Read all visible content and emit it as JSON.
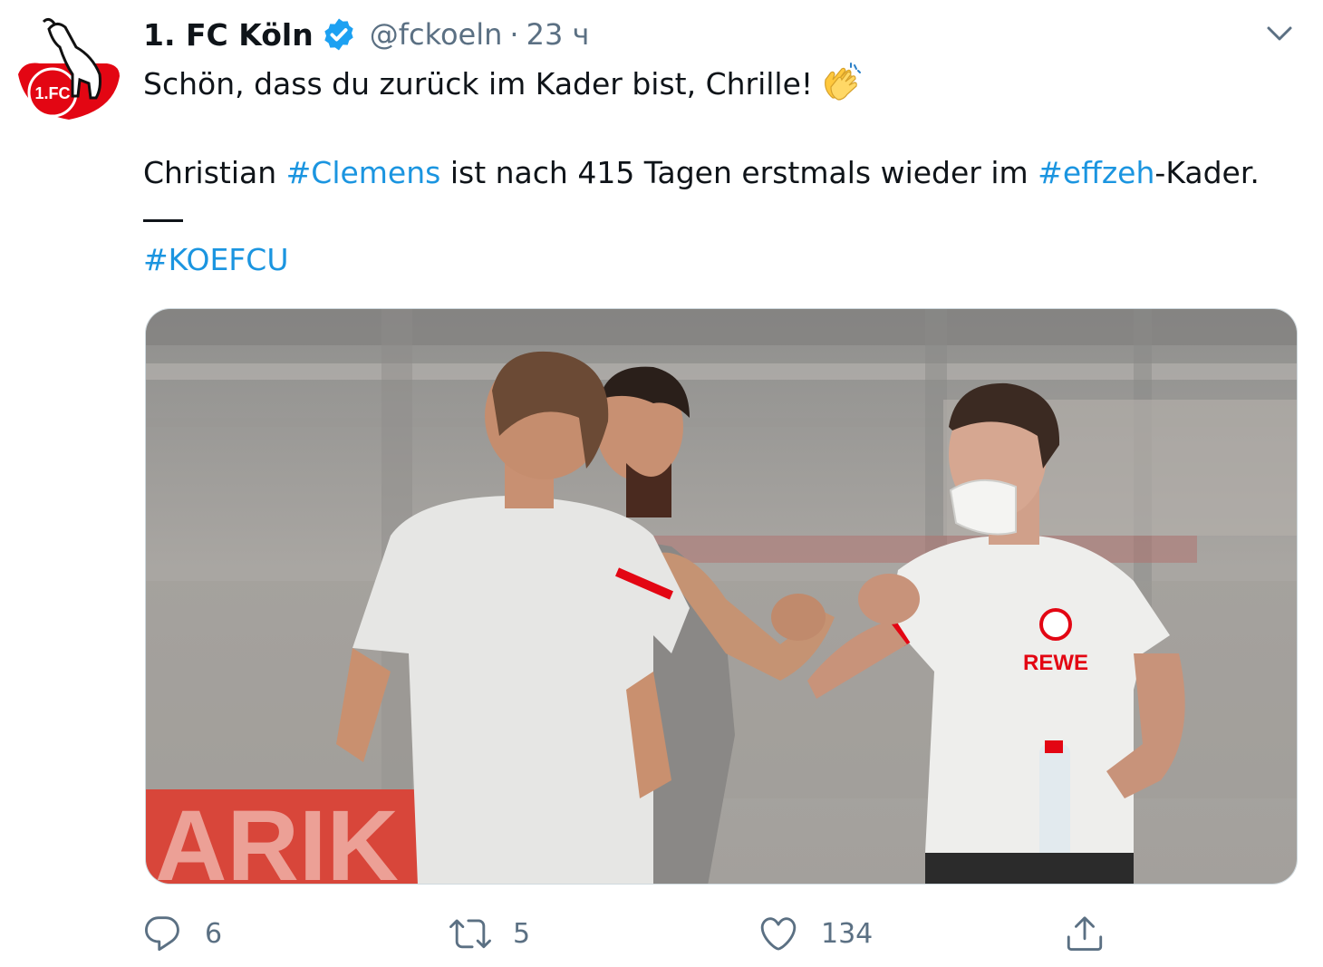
{
  "tweet": {
    "author_name": "1. FC Köln",
    "handle": "@fckoeln",
    "separator": "·",
    "timestamp": "23 ч",
    "text_line1": "Schön, dass du zurück im Kader bist, Chrille!",
    "line2_part1": "Christian ",
    "line2_hashtag1": "#Clemens",
    "line2_part2": " ist nach 415 Tagen erstmals wieder im ",
    "line2_hashtag2": "#effzeh",
    "line2_part3": "-Kader.",
    "divider": "__",
    "hashtag_line": "#KOEFCU",
    "verified": true,
    "emoji": "clapping-hands-emoji"
  },
  "media": {
    "logo_text": "REWE",
    "banner_text": "ARIK"
  },
  "actions": {
    "reply_count": "6",
    "retweet_count": "5",
    "like_count": "134"
  },
  "colors": {
    "hashtag": "#1b95e0",
    "verified_badge": "#1da1f2",
    "secondary_text": "#5b7083",
    "club_red": "#e30613"
  }
}
